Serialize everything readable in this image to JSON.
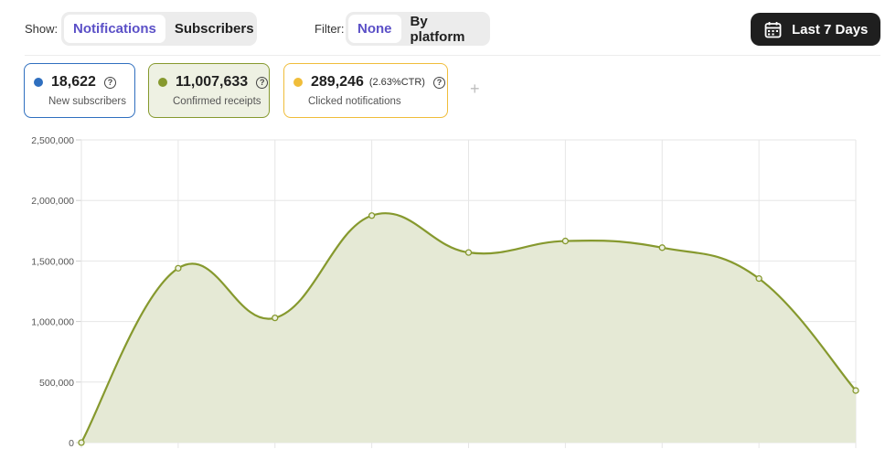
{
  "show": {
    "label": "Show:",
    "options": [
      "Notifications",
      "Subscribers"
    ],
    "selected": "Notifications"
  },
  "filter": {
    "label": "Filter:",
    "options": [
      "None",
      "By platform"
    ],
    "selected": "None"
  },
  "date_range": {
    "label": "Last 7 Days",
    "icon": "calendar-icon"
  },
  "cards": [
    {
      "value": "18,622",
      "ctr": "",
      "label": "New subscribers",
      "color": "#2f6fbf"
    },
    {
      "value": "11,007,633",
      "ctr": "",
      "label": "Confirmed receipts",
      "color": "#86992e"
    },
    {
      "value": "289,246",
      "ctr": "(2.63%CTR)",
      "label": "Clicked notifications",
      "color": "#f0bd3a"
    }
  ],
  "add_label": "+",
  "chart_data": {
    "type": "area",
    "series": [
      {
        "values": [
          0,
          1440000,
          1030000,
          1875000,
          1570000,
          1665000,
          1610000,
          1355000,
          430000
        ]
      }
    ],
    "y_ticks": [
      "2,500,000",
      "2,000,000",
      "1,500,000",
      "1,000,000",
      "500,000",
      "0"
    ],
    "ylim": [
      0,
      2500000
    ],
    "grid": true,
    "line_color": "#86992e",
    "fill_color": "#e5e9d5"
  }
}
